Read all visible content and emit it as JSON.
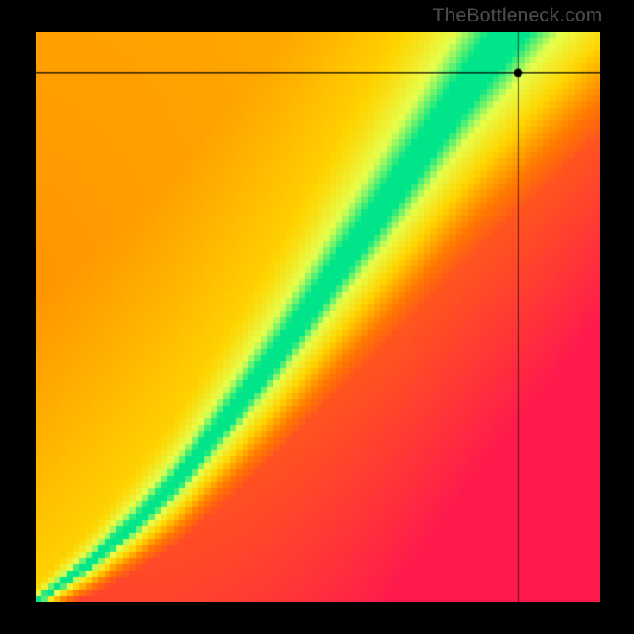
{
  "watermark": "TheBottleneck.com",
  "chart_data": {
    "type": "heatmap",
    "title": "",
    "xlabel": "",
    "ylabel": "",
    "xlim": [
      0,
      100
    ],
    "ylim": [
      0,
      100
    ],
    "colorscale": [
      {
        "stop": 0.0,
        "color": "#ff1a4d",
        "meaning": "severe bottleneck"
      },
      {
        "stop": 0.35,
        "color": "#ff7a00",
        "meaning": "high"
      },
      {
        "stop": 0.55,
        "color": "#ffd400",
        "meaning": "moderate"
      },
      {
        "stop": 0.75,
        "color": "#e6ff4d",
        "meaning": "low"
      },
      {
        "stop": 0.9,
        "color": "#00e58a",
        "meaning": "balanced"
      }
    ],
    "optimal_curve": {
      "description": "green balanced ridge through the field (x,y normalised 0-100)",
      "points": [
        {
          "x": 3,
          "y": 2
        },
        {
          "x": 10,
          "y": 7
        },
        {
          "x": 18,
          "y": 14
        },
        {
          "x": 26,
          "y": 22
        },
        {
          "x": 34,
          "y": 32
        },
        {
          "x": 42,
          "y": 42
        },
        {
          "x": 50,
          "y": 53
        },
        {
          "x": 58,
          "y": 64
        },
        {
          "x": 66,
          "y": 75
        },
        {
          "x": 73,
          "y": 85
        },
        {
          "x": 79,
          "y": 93
        },
        {
          "x": 83,
          "y": 98
        }
      ]
    },
    "crosshair": {
      "x": 85.5,
      "y": 92.8,
      "note": "user-selected point with guide lines to axes"
    },
    "pixelation": 90,
    "background_color": "#000000"
  }
}
